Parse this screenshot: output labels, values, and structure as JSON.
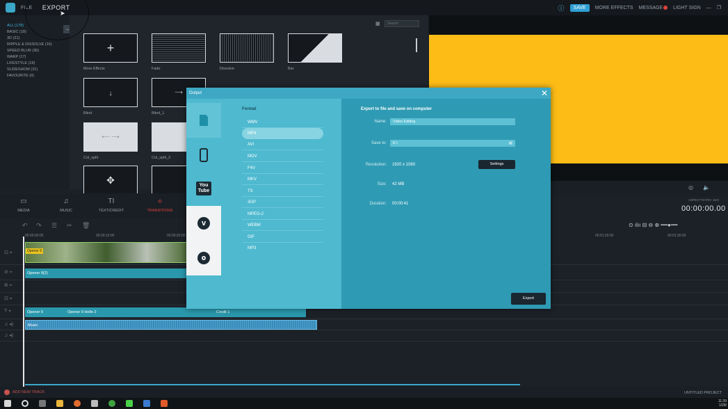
{
  "topbar": {
    "file": "FILE",
    "export": "EXPORT",
    "save": "SAVE",
    "more_effects": "MORE EFFECTS",
    "message": "MESSAGE",
    "login": "LIGHT SIGN"
  },
  "sidebar": {
    "items": [
      {
        "label": "ALL (178)",
        "active": true
      },
      {
        "label": "BASIC (18)"
      },
      {
        "label": "3D (21)"
      },
      {
        "label": "RIPPLE & DISSOLVE (16)"
      },
      {
        "label": "SPEED BLUR (36)"
      },
      {
        "label": "WARP (17)"
      },
      {
        "label": "LIFESTYLE (19)"
      },
      {
        "label": "SLIDESHOW (31)"
      },
      {
        "label": "FAVOURITE (0)"
      }
    ]
  },
  "library": {
    "search_placeholder": "Search",
    "items": [
      "More Effects",
      "Fade",
      "Dissolve",
      "Bar",
      "Blind",
      "Blind_1",
      "Col_split",
      "Col_split_2"
    ]
  },
  "tabs": [
    {
      "label": "MEDIA",
      "icon": "folder-icon"
    },
    {
      "label": "MUSIC",
      "icon": "music-icon"
    },
    {
      "label": "TEXT/CREDIT",
      "icon": "text-icon"
    },
    {
      "label": "TRANSITIONS",
      "icon": "transition-icon",
      "active": true
    }
  ],
  "preview": {
    "aspect_ratio": "ASPECT RATIO: 16:9",
    "timecode": "00:00:00.00"
  },
  "timeline": {
    "ruler": [
      "00:00:00:00",
      "00:00:10:00",
      "00:00:20:00",
      "00:01:20:00",
      "00:01:30:00"
    ],
    "clips": {
      "video_label": "Opener 9",
      "overlay": "Opener 9(2)",
      "text1": "Opener 9",
      "text2": "Opener 9 Hello 2",
      "text3": "Credit 1",
      "music": "Music"
    },
    "add_track": "ADD NEW TRACK",
    "project": "UNTITLED PROJECT"
  },
  "dialog": {
    "title": "Output",
    "format_header": "Format",
    "formats": [
      "WMV",
      "MP4",
      "AVI",
      "MOV",
      "F4V",
      "MKV",
      "TS",
      "3GP",
      "MPEG-2",
      "WEBM",
      "GIF",
      "MP3"
    ],
    "selected_format": "MP4",
    "destinations": [
      "device-icon",
      "phone-icon",
      "youtube-icon",
      "vimeo-icon",
      "dvd-icon"
    ],
    "export_header": "Export to file and save on computer",
    "name_label": "Name:",
    "name_value": "Video Editing",
    "save_to_label": "Save to:",
    "save_to_value": "E:\\",
    "resolution_label": "Resolution:",
    "resolution_value": "1920 x 1080",
    "settings_button": "Settings",
    "size_label": "Size:",
    "size_value": "42 MB",
    "duration_label": "Duration:",
    "duration_value": "00:00:41",
    "export_button": "Export"
  },
  "taskbar": {
    "time": "11:39",
    "date": "1/28/"
  }
}
